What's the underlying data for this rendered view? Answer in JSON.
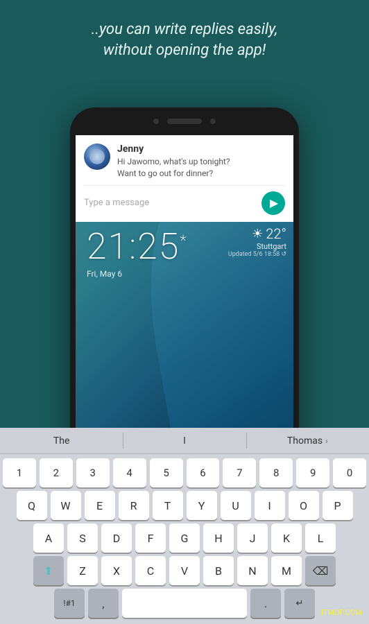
{
  "header": {
    "line1": "..you can write replies easily,",
    "line2": "without opening the app!"
  },
  "notification": {
    "sender": "Jenny",
    "message_line1": "Hi Jawomo, what's up tonight?",
    "message_line2": "Want to go out for dinner?",
    "input_placeholder": "Type a message"
  },
  "lockscreen": {
    "time": "21:25",
    "asterisk": "*",
    "date": "Fri, May 6"
  },
  "weather": {
    "icon": "☀",
    "temperature": "22°",
    "city": "Stuttgart",
    "updated": "Updated 5/6 18:58 ↺"
  },
  "autocomplete": {
    "option1": "The",
    "option2": "I",
    "option3": "Thomas",
    "arrow": "›"
  },
  "keyboard": {
    "row_numbers": [
      "1",
      "2",
      "3",
      "4",
      "5",
      "6",
      "7",
      "8",
      "9",
      "0"
    ],
    "row_q": [
      "Q",
      "W",
      "E",
      "R",
      "T",
      "Y",
      "U",
      "I",
      "O",
      "P"
    ],
    "row_a": [
      "A",
      "S",
      "D",
      "F",
      "G",
      "H",
      "J",
      "K",
      "L"
    ],
    "row_z": [
      "Z",
      "X",
      "C",
      "V",
      "B",
      "N",
      "M"
    ],
    "shift_icon": "⬆",
    "delete_icon": "⌫",
    "space_label": "",
    "return_icon": "↵"
  },
  "watermark": "ITMOP.COM"
}
